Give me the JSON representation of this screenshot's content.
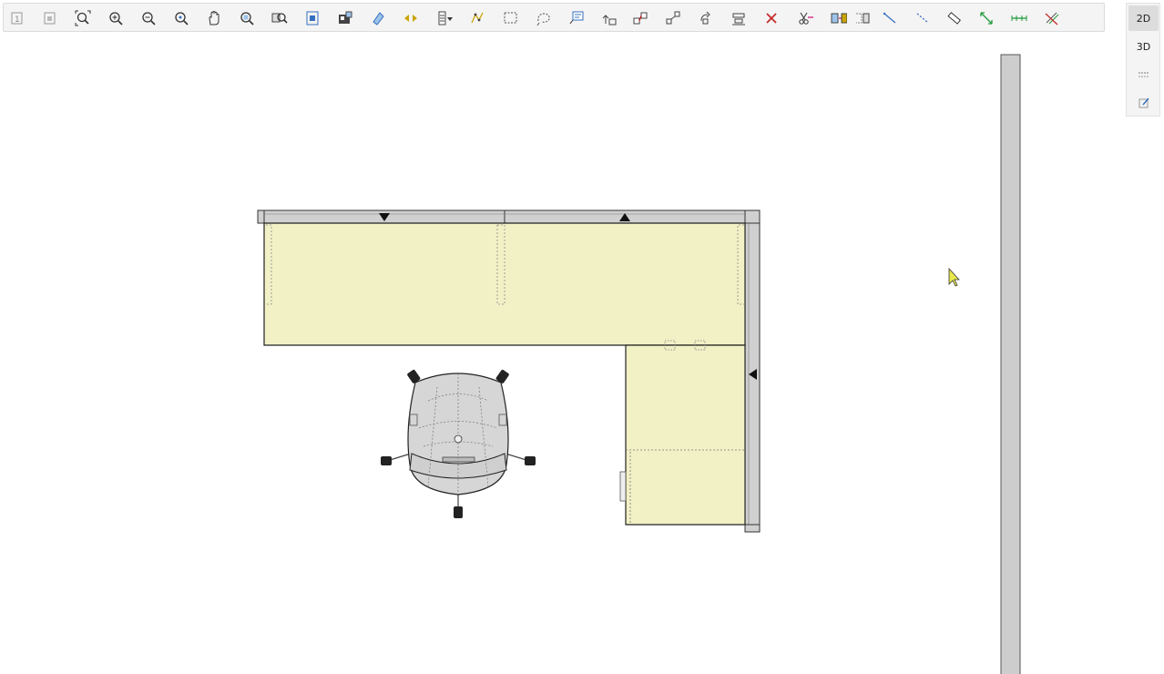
{
  "toolbar": {
    "buttons": [
      {
        "id": "select-1",
        "icon": "select-icon"
      },
      {
        "id": "select-2",
        "icon": "select-group-icon"
      },
      {
        "id": "zoom-fit",
        "icon": "zoom-fit-icon"
      },
      {
        "id": "zoom-in",
        "icon": "zoom-in-icon"
      },
      {
        "id": "zoom-out",
        "icon": "zoom-out-icon"
      },
      {
        "id": "zoom-prev",
        "icon": "zoom-previous-icon"
      },
      {
        "id": "pan",
        "icon": "pan-hand-icon"
      },
      {
        "id": "zoom-window",
        "icon": "zoom-window-icon"
      },
      {
        "id": "zoom-all",
        "icon": "zoom-all-icon"
      },
      {
        "id": "frame",
        "icon": "frame-icon"
      },
      {
        "id": "catalog",
        "icon": "catalog-icon"
      },
      {
        "id": "paint",
        "icon": "paint-icon"
      },
      {
        "id": "move",
        "icon": "move-arrows-icon"
      },
      {
        "id": "layers",
        "icon": "layers-dropdown-icon"
      },
      {
        "id": "polyline",
        "icon": "polyline-icon"
      },
      {
        "id": "rect-select",
        "icon": "rectangle-select-icon"
      },
      {
        "id": "lasso",
        "icon": "lasso-icon"
      },
      {
        "id": "annotation",
        "icon": "annotation-icon"
      },
      {
        "id": "insert",
        "icon": "insert-icon"
      },
      {
        "id": "connect",
        "icon": "connect-icon"
      },
      {
        "id": "scale",
        "icon": "scale-icon"
      },
      {
        "id": "rotate",
        "icon": "rotate-icon"
      },
      {
        "id": "align",
        "icon": "align-icon"
      },
      {
        "id": "delete",
        "icon": "delete-x-icon"
      },
      {
        "id": "cut-paste",
        "icon": "cut-icon"
      },
      {
        "id": "replace",
        "icon": "replace-icon"
      },
      {
        "id": "mirror",
        "icon": "mirror-icon"
      },
      {
        "id": "line",
        "icon": "line-icon"
      },
      {
        "id": "dash-line",
        "icon": "dashed-line-icon"
      },
      {
        "id": "measure",
        "icon": "ruler-icon"
      },
      {
        "id": "dimension",
        "icon": "dimension-icon"
      },
      {
        "id": "dim-chain",
        "icon": "dimension-chain-icon"
      },
      {
        "id": "hide-dim",
        "icon": "hide-dimension-icon"
      }
    ]
  },
  "viewpanel": {
    "btn_2d": "2D",
    "btn_3d": "3D",
    "active": "2D"
  },
  "colors": {
    "desk_fill": "#f2f1c6",
    "panel_fill": "#d0d0d0",
    "chair_fill": "#d6d6d6",
    "wall_fill": "#cdcdcd",
    "cursor_fill": "#e7e84b"
  }
}
